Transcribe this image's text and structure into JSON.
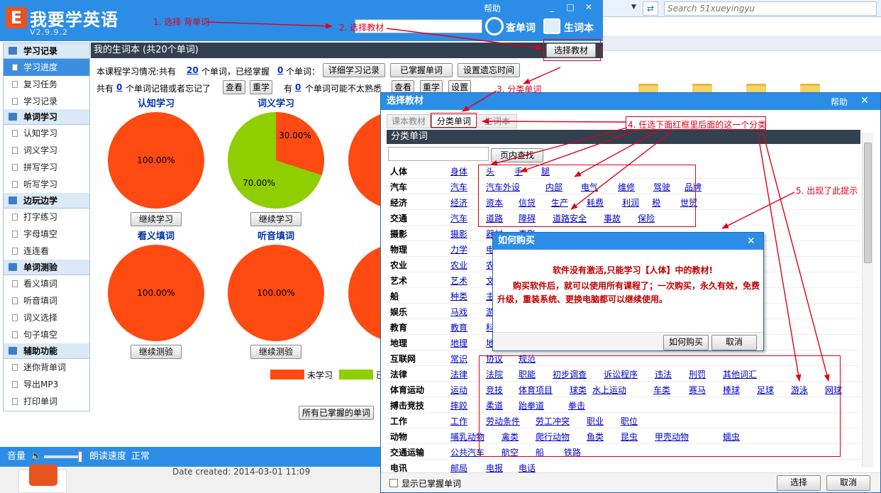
{
  "app": {
    "name": "我要学英语",
    "version": "V2.9.9.2",
    "help": "帮助",
    "lookup_label": "查单词",
    "vocab_label": "生词本",
    "window_buttons": [
      "_",
      "□",
      "✕"
    ]
  },
  "background_window": {
    "search_placeholder": "Search 51xueyingyu",
    "refresh_glyph": "⇄"
  },
  "sidebar": {
    "groups": [
      {
        "label": "学习记录",
        "items": [
          "学习进度",
          "复习任务",
          "学习记录"
        ]
      },
      {
        "label": "单词学习",
        "items": [
          "认知学习",
          "词义学习",
          "拼写学习",
          "听写学习"
        ]
      },
      {
        "label": "边玩边学",
        "items": [
          "打字练习",
          "字母填空",
          "连连看"
        ]
      },
      {
        "label": "单词测验",
        "items": [
          "看义填词",
          "听音填词",
          "词义选择",
          "句子填空"
        ]
      },
      {
        "label": "辅助功能",
        "items": [
          "迷你背单词",
          "导出MP3",
          "打印单词"
        ]
      }
    ],
    "selected": "学习进度"
  },
  "content": {
    "header": "我的生词本 (共20个单词)",
    "select_book_button": "选择教材",
    "stats_line1_a": "本课程学习情况:共有",
    "total_words": "20",
    "stats_line1_b": "个单词，已经掌握",
    "mastered": "0",
    "stats_line1_c": "个单词：",
    "detail_button": "详细学习记录",
    "mastered_button": "已掌握单词",
    "forget_time_button": "设置遗忘时间",
    "stats_line2_a": "共有",
    "wrong_words": "0",
    "stats_line2_b": "个单词记错或者忘记了",
    "view_button": "查看",
    "relearn_button": "重学",
    "stats_line2_c": "有",
    "unfamiliar": "0",
    "stats_line2_d": "个单词可能不太熟悉",
    "set_button": "设置",
    "cards": [
      {
        "title": "认知学习",
        "pct_not": 100.0,
        "label1": "100.00%",
        "button": "继续学习"
      },
      {
        "title": "词义学习",
        "pct_learned": 30.0,
        "pct_not": 70.0,
        "label1": "30.00%",
        "label2": "70.00%",
        "button": "继续学习"
      },
      {
        "title": "看义填词",
        "pct_not": 100.0,
        "label1": "100.00%",
        "button": "继续测验"
      },
      {
        "title": "听音填词",
        "pct_not": 100.0,
        "label1": "100.00%",
        "button": "继续测验"
      }
    ],
    "legend_not": "未学习",
    "legend_learned": "已",
    "all_mastered_button": "所有已掌握的单词"
  },
  "bottom_bar": {
    "volume_label": "音量",
    "speed_label": "朗读速度",
    "speed_value": "正常",
    "date_created": "Date created:  2014-03-01 11:09"
  },
  "dialog": {
    "title": "选择教材",
    "help": "帮助",
    "tabs": [
      "课本教材",
      "分类单词",
      "生词本"
    ],
    "active_tab": "分类单词",
    "subheader": "分类单词",
    "search_button": "页内查找",
    "categories": [
      {
        "name": "人体",
        "subs": [
          "身体",
          "头",
          "手",
          "腿"
        ]
      },
      {
        "name": "汽车",
        "subs": [
          "汽车",
          "汽车外设",
          "内部",
          "电气",
          "维修",
          "驾驶",
          "品牌"
        ]
      },
      {
        "name": "经济",
        "subs": [
          "经济",
          "资本",
          "信贷",
          "生产",
          "耗费",
          "利润",
          "税",
          "世贸"
        ]
      },
      {
        "name": "交通",
        "subs": [
          "汽车",
          "道路",
          "障碍",
          "道路安全",
          "事故",
          "保险"
        ]
      },
      {
        "name": "摄影",
        "subs": [
          "摄影",
          "器材",
          "事影"
        ]
      },
      {
        "name": "物理",
        "subs": [
          "力学",
          "电学"
        ]
      },
      {
        "name": "农业",
        "subs": [
          "农业",
          "农场"
        ]
      },
      {
        "name": "艺术",
        "subs": [
          "艺术",
          "文学"
        ]
      },
      {
        "name": "船",
        "subs": [
          "种类",
          "主要"
        ]
      },
      {
        "name": "娱乐",
        "subs": [
          "马戏",
          "游乐"
        ]
      },
      {
        "name": "教育",
        "subs": [
          "教育",
          "科目"
        ]
      },
      {
        "name": "地理",
        "subs": [
          "地理",
          "地图"
        ]
      },
      {
        "name": "互联网",
        "subs": [
          "常识",
          "协议",
          "规范"
        ]
      },
      {
        "name": "法律",
        "subs": [
          "法律",
          "法院",
          "职能",
          "初步调查",
          "诉讼程序",
          "违法",
          "刑罚",
          "其他词汇"
        ]
      },
      {
        "name": "体育运动",
        "subs": [
          "运动",
          "竞技",
          "体育项目",
          "球类",
          "水上运动",
          "车类",
          "赛马",
          "棒球",
          "足球",
          "游泳",
          "网球"
        ]
      },
      {
        "name": "搏击竞技",
        "subs": [
          "摔跤",
          "柔道",
          "跆拳道",
          "拳击"
        ]
      },
      {
        "name": "工作",
        "subs": [
          "工作",
          "劳动条件",
          "劳工冲突",
          "职业",
          "职位"
        ]
      },
      {
        "name": "动物",
        "subs": [
          "哺乳动物",
          "禽类",
          "爬行动物",
          "鱼类",
          "昆虫",
          "甲壳动物",
          "蠕虫"
        ]
      },
      {
        "name": "交通运输",
        "subs": [
          "公共汽车",
          "航空",
          "船",
          "铁路"
        ]
      },
      {
        "name": "电讯",
        "subs": [
          "邮局",
          "电报",
          "电话"
        ]
      }
    ],
    "show_mastered_label": "显示已掌握单词",
    "select_button": "选择",
    "cancel_button": "取消"
  },
  "popup": {
    "title": "如何购买",
    "line1": "软件没有激活,只能学习【人体】中的教材!",
    "line2": "购买软件后，就可以使用所有课程了；一次购买，永久有效，免费升级，重装系统、更换电脑都可以继续使用。",
    "buy_button": "如何购买",
    "cancel_button": "取消"
  },
  "annotations": {
    "a1": "1. 选择 背单词",
    "a2": "2. 选择教材",
    "a3": "3. 分类单词",
    "a4": "4. 任选下面红框里后面的这一个分类",
    "a5": "5. 出现了此提示"
  },
  "colors": {
    "title_blue": "#2c8de6",
    "not_learned": "#ff4a12",
    "learned": "#8fce00",
    "annotation_red": "#e0001a"
  }
}
